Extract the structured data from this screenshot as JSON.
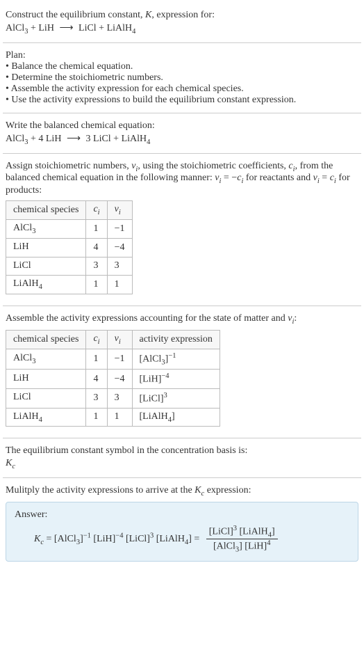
{
  "header": {
    "prompt_line1": "Construct the equilibrium constant, ",
    "prompt_k": "K",
    "prompt_line1b": ", expression for:",
    "equation_unbalanced_lhs1": "AlCl",
    "equation_unbalanced_lhs1_sub": "3",
    "equation_unbalanced_plus1": " + LiH ",
    "equation_unbalanced_arrow": "⟶",
    "equation_unbalanced_rhs1": " LiCl + LiAlH",
    "equation_unbalanced_rhs1_sub": "4"
  },
  "plan": {
    "title": "Plan:",
    "b1": "• Balance the chemical equation.",
    "b2": "• Determine the stoichiometric numbers.",
    "b3": "• Assemble the activity expression for each chemical species.",
    "b4": "• Use the activity expressions to build the equilibrium constant expression."
  },
  "balanced": {
    "title": "Write the balanced chemical equation:",
    "lhs1": "AlCl",
    "lhs1_sub": "3",
    "plus1": " + 4 LiH ",
    "arrow": "⟶",
    "rhs": " 3 LiCl + LiAlH",
    "rhs_sub": "4"
  },
  "assign": {
    "text_a": "Assign stoichiometric numbers, ",
    "nu": "ν",
    "sub_i": "i",
    "text_b": ", using the stoichiometric coefficients, ",
    "c": "c",
    "text_c": ", from the balanced chemical equation in the following manner: ",
    "eq1a": " = −",
    "text_d": " for reactants and ",
    "eq2a": " = ",
    "text_e": " for products:",
    "table": {
      "h1": "chemical species",
      "h2": "c",
      "h3": "ν",
      "r1": {
        "sp": "AlCl",
        "sp_sub": "3",
        "c": "1",
        "nu": "−1"
      },
      "r2": {
        "sp": "LiH",
        "sp_sub": "",
        "c": "4",
        "nu": "−4"
      },
      "r3": {
        "sp": "LiCl",
        "sp_sub": "",
        "c": "3",
        "nu": "3"
      },
      "r4": {
        "sp": "LiAlH",
        "sp_sub": "4",
        "c": "1",
        "nu": "1"
      }
    }
  },
  "activity": {
    "text_a": "Assemble the activity expressions accounting for the state of matter and ",
    "text_b": ":",
    "table": {
      "h1": "chemical species",
      "h2": "c",
      "h3": "ν",
      "h4": "activity expression",
      "r1": {
        "sp": "AlCl",
        "sp_sub": "3",
        "c": "1",
        "nu": "−1",
        "ax_base": "[AlCl",
        "ax_sub": "3",
        "ax_close": "]",
        "ax_sup": "−1"
      },
      "r2": {
        "sp": "LiH",
        "sp_sub": "",
        "c": "4",
        "nu": "−4",
        "ax_base": "[LiH]",
        "ax_sub": "",
        "ax_close": "",
        "ax_sup": "−4"
      },
      "r3": {
        "sp": "LiCl",
        "sp_sub": "",
        "c": "3",
        "nu": "3",
        "ax_base": "[LiCl]",
        "ax_sub": "",
        "ax_close": "",
        "ax_sup": "3"
      },
      "r4": {
        "sp": "LiAlH",
        "sp_sub": "4",
        "c": "1",
        "nu": "1",
        "ax_base": "[LiAlH",
        "ax_sub": "4",
        "ax_close": "]",
        "ax_sup": ""
      }
    }
  },
  "symbol": {
    "text": "The equilibrium constant symbol in the concentration basis is:",
    "k": "K",
    "k_sub": "c"
  },
  "multiply": {
    "text_a": "Mulitply the activity expressions to arrive at the ",
    "k": "K",
    "k_sub": "c",
    "text_b": " expression:"
  },
  "answer": {
    "label": "Answer:",
    "lhs_k": "K",
    "lhs_k_sub": "c",
    "eq": " = ",
    "t1_base": "[AlCl",
    "t1_sub": "3",
    "t1_close": "]",
    "t1_sup": "−1",
    "sp": " ",
    "t2_base": "[LiH]",
    "t2_sup": "−4",
    "t3_base": "[LiCl]",
    "t3_sup": "3",
    "t4_base": "[LiAlH",
    "t4_sub": "4",
    "t4_close": "]",
    "eq2": " = ",
    "num_a": "[LiCl]",
    "num_a_sup": "3",
    "num_b": "[LiAlH",
    "num_b_sub": "4",
    "num_b_close": "]",
    "den_a": "[AlCl",
    "den_a_sub": "3",
    "den_a_close": "] ",
    "den_b": "[LiH]",
    "den_b_sup": "4"
  }
}
